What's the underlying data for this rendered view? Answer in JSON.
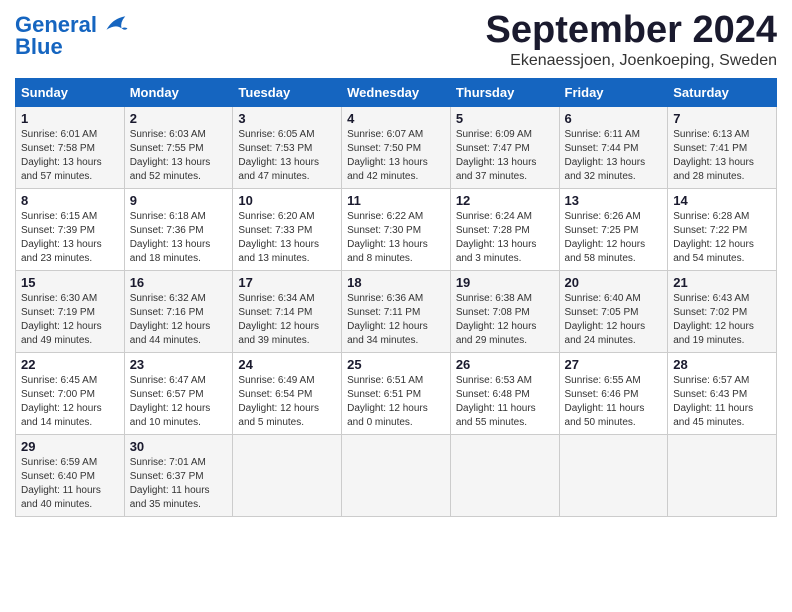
{
  "logo": {
    "line1": "General",
    "line2": "Blue"
  },
  "title": "September 2024",
  "location": "Ekenaessjoen, Joenkoeping, Sweden",
  "days_of_week": [
    "Sunday",
    "Monday",
    "Tuesday",
    "Wednesday",
    "Thursday",
    "Friday",
    "Saturday"
  ],
  "weeks": [
    [
      {
        "day": "1",
        "info": "Sunrise: 6:01 AM\nSunset: 7:58 PM\nDaylight: 13 hours\nand 57 minutes."
      },
      {
        "day": "2",
        "info": "Sunrise: 6:03 AM\nSunset: 7:55 PM\nDaylight: 13 hours\nand 52 minutes."
      },
      {
        "day": "3",
        "info": "Sunrise: 6:05 AM\nSunset: 7:53 PM\nDaylight: 13 hours\nand 47 minutes."
      },
      {
        "day": "4",
        "info": "Sunrise: 6:07 AM\nSunset: 7:50 PM\nDaylight: 13 hours\nand 42 minutes."
      },
      {
        "day": "5",
        "info": "Sunrise: 6:09 AM\nSunset: 7:47 PM\nDaylight: 13 hours\nand 37 minutes."
      },
      {
        "day": "6",
        "info": "Sunrise: 6:11 AM\nSunset: 7:44 PM\nDaylight: 13 hours\nand 32 minutes."
      },
      {
        "day": "7",
        "info": "Sunrise: 6:13 AM\nSunset: 7:41 PM\nDaylight: 13 hours\nand 28 minutes."
      }
    ],
    [
      {
        "day": "8",
        "info": "Sunrise: 6:15 AM\nSunset: 7:39 PM\nDaylight: 13 hours\nand 23 minutes."
      },
      {
        "day": "9",
        "info": "Sunrise: 6:18 AM\nSunset: 7:36 PM\nDaylight: 13 hours\nand 18 minutes."
      },
      {
        "day": "10",
        "info": "Sunrise: 6:20 AM\nSunset: 7:33 PM\nDaylight: 13 hours\nand 13 minutes."
      },
      {
        "day": "11",
        "info": "Sunrise: 6:22 AM\nSunset: 7:30 PM\nDaylight: 13 hours\nand 8 minutes."
      },
      {
        "day": "12",
        "info": "Sunrise: 6:24 AM\nSunset: 7:28 PM\nDaylight: 13 hours\nand 3 minutes."
      },
      {
        "day": "13",
        "info": "Sunrise: 6:26 AM\nSunset: 7:25 PM\nDaylight: 12 hours\nand 58 minutes."
      },
      {
        "day": "14",
        "info": "Sunrise: 6:28 AM\nSunset: 7:22 PM\nDaylight: 12 hours\nand 54 minutes."
      }
    ],
    [
      {
        "day": "15",
        "info": "Sunrise: 6:30 AM\nSunset: 7:19 PM\nDaylight: 12 hours\nand 49 minutes."
      },
      {
        "day": "16",
        "info": "Sunrise: 6:32 AM\nSunset: 7:16 PM\nDaylight: 12 hours\nand 44 minutes."
      },
      {
        "day": "17",
        "info": "Sunrise: 6:34 AM\nSunset: 7:14 PM\nDaylight: 12 hours\nand 39 minutes."
      },
      {
        "day": "18",
        "info": "Sunrise: 6:36 AM\nSunset: 7:11 PM\nDaylight: 12 hours\nand 34 minutes."
      },
      {
        "day": "19",
        "info": "Sunrise: 6:38 AM\nSunset: 7:08 PM\nDaylight: 12 hours\nand 29 minutes."
      },
      {
        "day": "20",
        "info": "Sunrise: 6:40 AM\nSunset: 7:05 PM\nDaylight: 12 hours\nand 24 minutes."
      },
      {
        "day": "21",
        "info": "Sunrise: 6:43 AM\nSunset: 7:02 PM\nDaylight: 12 hours\nand 19 minutes."
      }
    ],
    [
      {
        "day": "22",
        "info": "Sunrise: 6:45 AM\nSunset: 7:00 PM\nDaylight: 12 hours\nand 14 minutes."
      },
      {
        "day": "23",
        "info": "Sunrise: 6:47 AM\nSunset: 6:57 PM\nDaylight: 12 hours\nand 10 minutes."
      },
      {
        "day": "24",
        "info": "Sunrise: 6:49 AM\nSunset: 6:54 PM\nDaylight: 12 hours\nand 5 minutes."
      },
      {
        "day": "25",
        "info": "Sunrise: 6:51 AM\nSunset: 6:51 PM\nDaylight: 12 hours\nand 0 minutes."
      },
      {
        "day": "26",
        "info": "Sunrise: 6:53 AM\nSunset: 6:48 PM\nDaylight: 11 hours\nand 55 minutes."
      },
      {
        "day": "27",
        "info": "Sunrise: 6:55 AM\nSunset: 6:46 PM\nDaylight: 11 hours\nand 50 minutes."
      },
      {
        "day": "28",
        "info": "Sunrise: 6:57 AM\nSunset: 6:43 PM\nDaylight: 11 hours\nand 45 minutes."
      }
    ],
    [
      {
        "day": "29",
        "info": "Sunrise: 6:59 AM\nSunset: 6:40 PM\nDaylight: 11 hours\nand 40 minutes."
      },
      {
        "day": "30",
        "info": "Sunrise: 7:01 AM\nSunset: 6:37 PM\nDaylight: 11 hours\nand 35 minutes."
      },
      {
        "day": "",
        "info": ""
      },
      {
        "day": "",
        "info": ""
      },
      {
        "day": "",
        "info": ""
      },
      {
        "day": "",
        "info": ""
      },
      {
        "day": "",
        "info": ""
      }
    ]
  ]
}
